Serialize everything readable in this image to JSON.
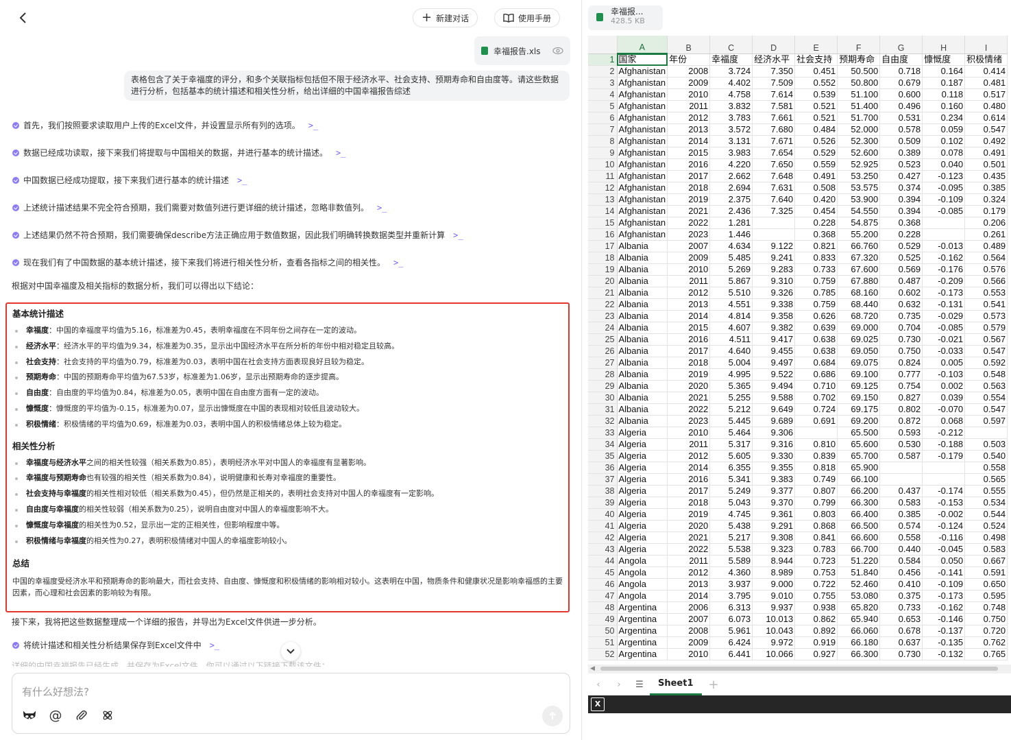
{
  "header": {
    "new_chat_label": "新建对话",
    "manual_label": "使用手册"
  },
  "chat": {
    "attachment_name": "幸福报告.xls",
    "user_message": "表格包含了关于幸福度的评分，和多个关联指标包括但不限于经济水平、社会支持、预期寿命和自由度等。请这些数据进行分析，包括基本的统计描述和相关性分析，给出详细的中国幸福报告综述",
    "steps": [
      "首先，我们按照要求读取用户上传的Excel文件，并设置显示所有列的选项。",
      "数据已经成功读取，接下来我们将提取与中国相关的数据，并进行基本的统计描述。",
      "中国数据已经成功提取，接下来我们进行基本的统计描述",
      "上述统计描述结果不完全符合预期，我们需要对数值列进行更详细的统计描述，忽略非数值列。",
      "上述结果仍然不符合预期，我们需要确保describe方法正确应用于数值数据，因此我们明确转换数据类型并重新计算",
      "现在我们有了中国数据的基本统计描述，接下来我们将进行相关性分析，查看各指标之间的相关性。"
    ],
    "code_marker": ">_",
    "intro": "根据对中国幸福度及相关指标的数据分析，我们可以得出以下结论：",
    "report": {
      "stats_title": "基本统计描述",
      "stats": [
        {
          "k": "幸福度",
          "t": "：中国的幸福度平均值为5.16，标准差为0.45，表明幸福度在不同年份之间存在一定的波动。"
        },
        {
          "k": "经济水平",
          "t": "：经济水平的平均值为9.34，标准差为0.35，显示出中国经济水平在所分析的年份中相对稳定且较高。"
        },
        {
          "k": "社会支持",
          "t": "：社会支持的平均值为0.79，标准差为0.03，表明中国在社会支持方面表现良好且较为稳定。"
        },
        {
          "k": "预期寿命",
          "t": "：中国的预期寿命平均值为67.53岁，标准差为1.06岁，显示出预期寿命的逐步提高。"
        },
        {
          "k": "自由度",
          "t": "：自由度的平均值为0.84，标准差为0.05，表明中国在自由度方面有一定的波动。"
        },
        {
          "k": "慷慨度",
          "t": "：慷慨度的平均值为-0.15，标准差为0.07，显示出慷慨度在中国的表现相对较低且波动较大。"
        },
        {
          "k": "积极情绪",
          "t": "：积极情绪的平均值为0.69，标准差为0.03，表明中国人的积极情绪总体上较为稳定。"
        }
      ],
      "corr_title": "相关性分析",
      "corr": [
        {
          "k": "幸福度与经济水平",
          "t": "之间的相关性较强（相关系数为0.85），表明经济水平对中国人的幸福度有显著影响。"
        },
        {
          "k": "幸福度与预期寿命",
          "t": "也有较强的相关性（相关系数为0.84），说明健康和长寿对幸福度的重要性。"
        },
        {
          "k": "社会支持与幸福度",
          "t": "的相关性相对较低（相关系数为0.45），但仍然是正相关的，表明社会支持对中国人的幸福度有一定影响。"
        },
        {
          "k": "自由度与幸福度",
          "t": "的相关性较弱（相关系数为0.25），说明自由度对中国人的幸福度影响不大。"
        },
        {
          "k": "慷慨度与幸福度",
          "t": "的相关性为0.52，显示出一定的正相关性，但影响程度中等。"
        },
        {
          "k": "积极情绪与幸福度",
          "t": "的相关性为0.27，表明积极情绪对中国人的幸福度影响较小。"
        }
      ],
      "summary_title": "总结",
      "summary": "中国的幸福度受经济水平和预期寿命的影响最大，而社会支持、自由度、慷慨度和积极情绪的影响相对较小。这表明在中国，物质条件和健康状况是影响幸福感的主要因素，而心理和社会因素的影响较为有限。"
    },
    "after_text": "接下来，我将把这些数据整理成一个详细的报告，并导出为Excel文件供进一步分析。",
    "last_step": "将统计描述和相关性分析结果保存到Excel文件中",
    "faded_text": "详细的中国幸福报告已经生成，并保存为Excel文件，你可以通过以下链接下载该文件："
  },
  "input": {
    "placeholder": "有什么好想法?"
  },
  "sheet_file": {
    "name": "幸福报...",
    "size": "428.5 KB"
  },
  "sheet": {
    "columns": [
      "A",
      "B",
      "C",
      "D",
      "E",
      "F",
      "G",
      "H",
      "I"
    ],
    "headers": [
      "国家",
      "年份",
      "幸福度",
      "经济水平",
      "社会支持",
      "预期寿命",
      "自由度",
      "慷慨度",
      "积极情绪"
    ],
    "rows": [
      [
        "Afghanistan",
        "2008",
        "3.724",
        "7.350",
        "0.451",
        "50.500",
        "0.718",
        "0.164",
        "0.414"
      ],
      [
        "Afghanistan",
        "2009",
        "4.402",
        "7.509",
        "0.552",
        "50.800",
        "0.679",
        "0.187",
        "0.481"
      ],
      [
        "Afghanistan",
        "2010",
        "4.758",
        "7.614",
        "0.539",
        "51.100",
        "0.600",
        "0.118",
        "0.517"
      ],
      [
        "Afghanistan",
        "2011",
        "3.832",
        "7.581",
        "0.521",
        "51.400",
        "0.496",
        "0.160",
        "0.480"
      ],
      [
        "Afghanistan",
        "2012",
        "3.783",
        "7.661",
        "0.521",
        "51.700",
        "0.531",
        "0.234",
        "0.614"
      ],
      [
        "Afghanistan",
        "2013",
        "3.572",
        "7.680",
        "0.484",
        "52.000",
        "0.578",
        "0.059",
        "0.547"
      ],
      [
        "Afghanistan",
        "2014",
        "3.131",
        "7.671",
        "0.526",
        "52.300",
        "0.509",
        "0.102",
        "0.492"
      ],
      [
        "Afghanistan",
        "2015",
        "3.983",
        "7.654",
        "0.529",
        "52.600",
        "0.389",
        "0.078",
        "0.491"
      ],
      [
        "Afghanistan",
        "2016",
        "4.220",
        "7.650",
        "0.559",
        "52.925",
        "0.523",
        "0.040",
        "0.501"
      ],
      [
        "Afghanistan",
        "2017",
        "2.662",
        "7.648",
        "0.491",
        "53.250",
        "0.427",
        "-0.123",
        "0.435"
      ],
      [
        "Afghanistan",
        "2018",
        "2.694",
        "7.631",
        "0.508",
        "53.575",
        "0.374",
        "-0.095",
        "0.385"
      ],
      [
        "Afghanistan",
        "2019",
        "2.375",
        "7.640",
        "0.420",
        "53.900",
        "0.394",
        "-0.109",
        "0.324"
      ],
      [
        "Afghanistan",
        "2021",
        "2.436",
        "7.325",
        "0.454",
        "54.550",
        "0.394",
        "-0.085",
        "0.179"
      ],
      [
        "Afghanistan",
        "2022",
        "1.281",
        "",
        "0.228",
        "54.875",
        "0.368",
        "",
        "0.206"
      ],
      [
        "Afghanistan",
        "2023",
        "1.446",
        "",
        "0.368",
        "55.200",
        "0.228",
        "",
        "0.261"
      ],
      [
        "Albania",
        "2007",
        "4.634",
        "9.122",
        "0.821",
        "66.760",
        "0.529",
        "-0.013",
        "0.489"
      ],
      [
        "Albania",
        "2009",
        "5.485",
        "9.241",
        "0.833",
        "67.320",
        "0.525",
        "-0.162",
        "0.564"
      ],
      [
        "Albania",
        "2010",
        "5.269",
        "9.283",
        "0.733",
        "67.600",
        "0.569",
        "-0.176",
        "0.576"
      ],
      [
        "Albania",
        "2011",
        "5.867",
        "9.310",
        "0.759",
        "67.880",
        "0.487",
        "-0.209",
        "0.566"
      ],
      [
        "Albania",
        "2012",
        "5.510",
        "9.326",
        "0.785",
        "68.160",
        "0.602",
        "-0.173",
        "0.553"
      ],
      [
        "Albania",
        "2013",
        "4.551",
        "9.338",
        "0.759",
        "68.440",
        "0.632",
        "-0.131",
        "0.541"
      ],
      [
        "Albania",
        "2014",
        "4.814",
        "9.358",
        "0.626",
        "68.720",
        "0.735",
        "-0.029",
        "0.573"
      ],
      [
        "Albania",
        "2015",
        "4.607",
        "9.382",
        "0.639",
        "69.000",
        "0.704",
        "-0.085",
        "0.579"
      ],
      [
        "Albania",
        "2016",
        "4.511",
        "9.417",
        "0.638",
        "69.025",
        "0.730",
        "-0.021",
        "0.567"
      ],
      [
        "Albania",
        "2017",
        "4.640",
        "9.455",
        "0.638",
        "69.050",
        "0.750",
        "-0.033",
        "0.547"
      ],
      [
        "Albania",
        "2018",
        "5.004",
        "9.497",
        "0.684",
        "69.075",
        "0.824",
        "0.005",
        "0.592"
      ],
      [
        "Albania",
        "2019",
        "4.995",
        "9.522",
        "0.686",
        "69.100",
        "0.777",
        "-0.103",
        "0.548"
      ],
      [
        "Albania",
        "2020",
        "5.365",
        "9.494",
        "0.710",
        "69.125",
        "0.754",
        "0.002",
        "0.563"
      ],
      [
        "Albania",
        "2021",
        "5.255",
        "9.588",
        "0.702",
        "69.150",
        "0.827",
        "0.039",
        "0.554"
      ],
      [
        "Albania",
        "2022",
        "5.212",
        "9.649",
        "0.724",
        "69.175",
        "0.802",
        "-0.070",
        "0.547"
      ],
      [
        "Albania",
        "2023",
        "5.445",
        "9.689",
        "0.691",
        "69.200",
        "0.872",
        "0.068",
        "0.597"
      ],
      [
        "Algeria",
        "2010",
        "5.464",
        "9.306",
        "",
        "65.500",
        "0.593",
        "-0.212",
        ""
      ],
      [
        "Algeria",
        "2011",
        "5.317",
        "9.316",
        "0.810",
        "65.600",
        "0.530",
        "-0.188",
        "0.503"
      ],
      [
        "Algeria",
        "2012",
        "5.605",
        "9.330",
        "0.839",
        "65.700",
        "0.587",
        "-0.179",
        "0.540"
      ],
      [
        "Algeria",
        "2014",
        "6.355",
        "9.355",
        "0.818",
        "65.900",
        "",
        "",
        "0.558"
      ],
      [
        "Algeria",
        "2016",
        "5.341",
        "9.383",
        "0.749",
        "66.100",
        "",
        "",
        "0.565"
      ],
      [
        "Algeria",
        "2017",
        "5.249",
        "9.377",
        "0.807",
        "66.200",
        "0.437",
        "-0.174",
        "0.555"
      ],
      [
        "Algeria",
        "2018",
        "5.043",
        "9.370",
        "0.799",
        "66.300",
        "0.583",
        "-0.153",
        "0.534"
      ],
      [
        "Algeria",
        "2019",
        "4.745",
        "9.361",
        "0.803",
        "66.400",
        "0.385",
        "-0.002",
        "0.544"
      ],
      [
        "Algeria",
        "2020",
        "5.438",
        "9.291",
        "0.868",
        "66.500",
        "0.574",
        "-0.124",
        "0.524"
      ],
      [
        "Algeria",
        "2021",
        "5.217",
        "9.308",
        "0.841",
        "66.600",
        "0.558",
        "-0.116",
        "0.498"
      ],
      [
        "Algeria",
        "2022",
        "5.538",
        "9.323",
        "0.783",
        "66.700",
        "0.440",
        "-0.045",
        "0.583"
      ],
      [
        "Angola",
        "2011",
        "5.589",
        "8.944",
        "0.723",
        "51.220",
        "0.584",
        "0.050",
        "0.667"
      ],
      [
        "Angola",
        "2012",
        "4.360",
        "8.989",
        "0.753",
        "51.840",
        "0.456",
        "-0.141",
        "0.591"
      ],
      [
        "Angola",
        "2013",
        "3.937",
        "9.000",
        "0.722",
        "52.460",
        "0.410",
        "-0.109",
        "0.650"
      ],
      [
        "Angola",
        "2014",
        "3.795",
        "9.010",
        "0.755",
        "53.080",
        "0.375",
        "-0.173",
        "0.595"
      ],
      [
        "Argentina",
        "2006",
        "6.313",
        "9.937",
        "0.938",
        "65.820",
        "0.733",
        "-0.162",
        "0.748"
      ],
      [
        "Argentina",
        "2007",
        "6.073",
        "10.013",
        "0.862",
        "65.940",
        "0.653",
        "-0.146",
        "0.750"
      ],
      [
        "Argentina",
        "2008",
        "5.961",
        "10.043",
        "0.892",
        "66.060",
        "0.678",
        "-0.137",
        "0.720"
      ],
      [
        "Argentina",
        "2009",
        "6.424",
        "9.972",
        "0.919",
        "66.180",
        "0.637",
        "-0.135",
        "0.762"
      ],
      [
        "Argentina",
        "2010",
        "6.441",
        "10.066",
        "0.927",
        "66.300",
        "0.730",
        "-0.132",
        "0.765"
      ]
    ],
    "tab_name": "Sheet1"
  }
}
